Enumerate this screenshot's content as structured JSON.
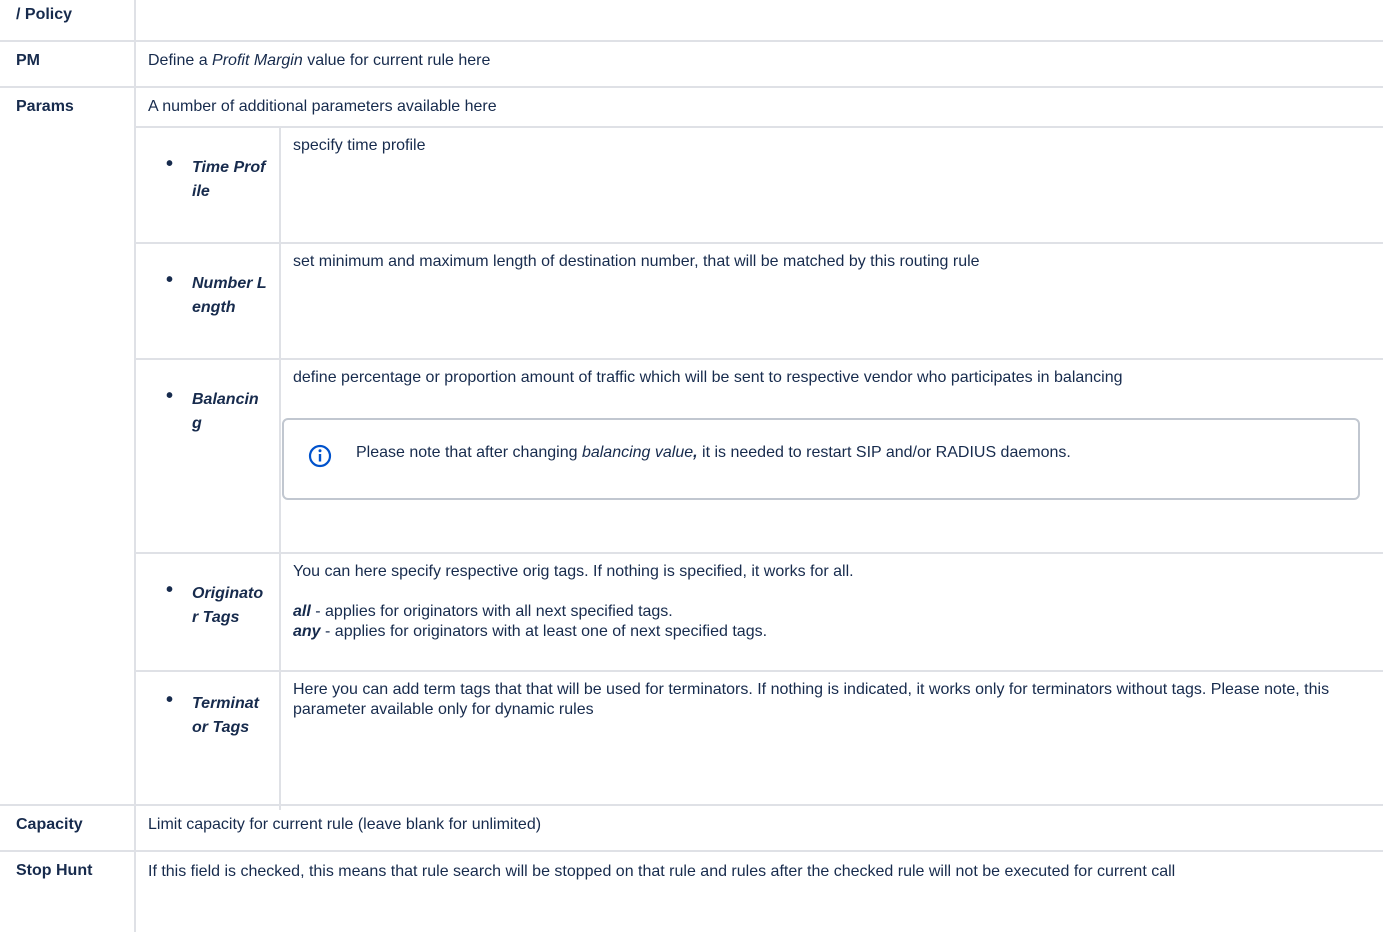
{
  "rows": {
    "policy": {
      "label": "/ Policy",
      "text": ""
    },
    "pm": {
      "label": "PM",
      "text_pre": "Define a ",
      "text_em": "Profit Margin",
      "text_post": " value for current rule here"
    },
    "params": {
      "label": "Params",
      "text": "A number of additional parameters available here"
    },
    "capacity": {
      "label": "Capacity",
      "text": "Limit capacity for current rule (leave blank for unlimited)"
    },
    "stophunt": {
      "label": "Stop Hunt",
      "text": "If this field is checked, this means that rule search will be stopped on that rule and rules after the checked rule will not be executed for current call"
    }
  },
  "params": [
    {
      "name": "Time Profile",
      "desc": "specify time profile"
    },
    {
      "name": "Number Length",
      "desc": "set minimum and maximum length of destination number, that will be matched by this routing rule"
    },
    {
      "name": "Balancing",
      "desc": "define percentage or proportion amount of traffic which will be sent to respective vendor who participates in balancing",
      "note_pre": "Please note that after changing ",
      "note_em": "balancing value",
      "note_comma": ",",
      "note_post": " it is needed to restart SIP and/or RADIUS daemons."
    },
    {
      "name": "Originator Tags",
      "desc": "You can here specify respective orig tags. If nothing is specified, it works for all.",
      "all_label": "all",
      "all_text": " - applies for originators with all next specified tags.",
      "any_label": "any",
      "any_text": " - applies for originators with at least one of next specified tags."
    },
    {
      "name": "Terminator Tags",
      "desc": "Here you can add term tags that that will be used for terminators. If nothing is indicated, it works only for terminators without tags. Please note, this parameter available only for dynamic rules"
    }
  ],
  "icons": {
    "info": "info-icon"
  },
  "colors": {
    "border": "#dfe1e6",
    "info": "#0052cc"
  }
}
